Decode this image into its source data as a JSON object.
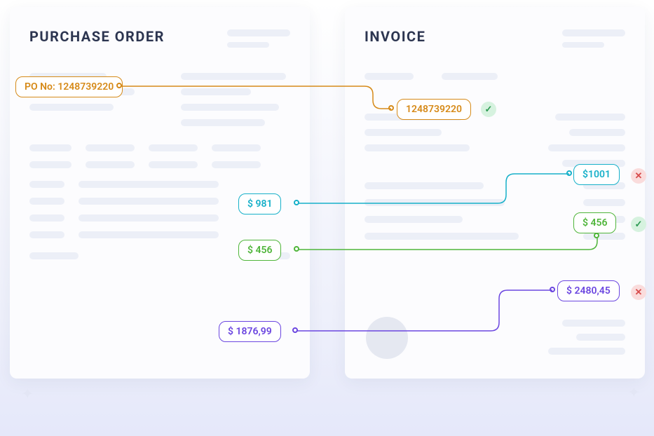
{
  "left_doc": {
    "title": "PURCHASE ORDER"
  },
  "right_doc": {
    "title": "INVOICE"
  },
  "pills": {
    "po_number_full": "PO No: 1248739220",
    "po_number": "1248739220",
    "amount_981": "$ 981",
    "amount_1001": "$1001",
    "amount_456_left": "$ 456",
    "amount_456_right": "$ 456",
    "total_left": "$ 1876,99",
    "total_right": "$ 2480,45"
  },
  "status": {
    "po_match": "ok",
    "line_981_1001": "err",
    "line_456_456": "ok",
    "total_match": "err"
  },
  "colors": {
    "amber": "#d68a18",
    "teal": "#16b0c9",
    "green": "#4fb53a",
    "purple": "#6b46e0"
  }
}
